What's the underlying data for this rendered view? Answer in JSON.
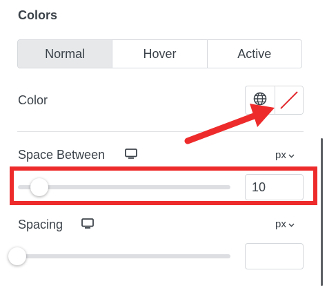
{
  "section": {
    "title": "Colors"
  },
  "tabs": [
    {
      "label": "Normal",
      "active": true
    },
    {
      "label": "Hover",
      "active": false
    },
    {
      "label": "Active",
      "active": false
    }
  ],
  "color": {
    "label": "Color",
    "globe_icon": "globe-icon",
    "swatch_state": "none",
    "swatch_slash_color": "#e2262b"
  },
  "space_between": {
    "label": "Space Between",
    "device_icon": "desktop-icon",
    "unit": "px",
    "value": "10",
    "slider_fraction": 0.1
  },
  "spacing": {
    "label": "Spacing",
    "device_icon": "desktop-icon",
    "unit": "px",
    "value": "",
    "slider_fraction": 0
  },
  "annotation": {
    "highlight_color": "#ee2b2b",
    "arrow_color": "#ee2b2b"
  }
}
